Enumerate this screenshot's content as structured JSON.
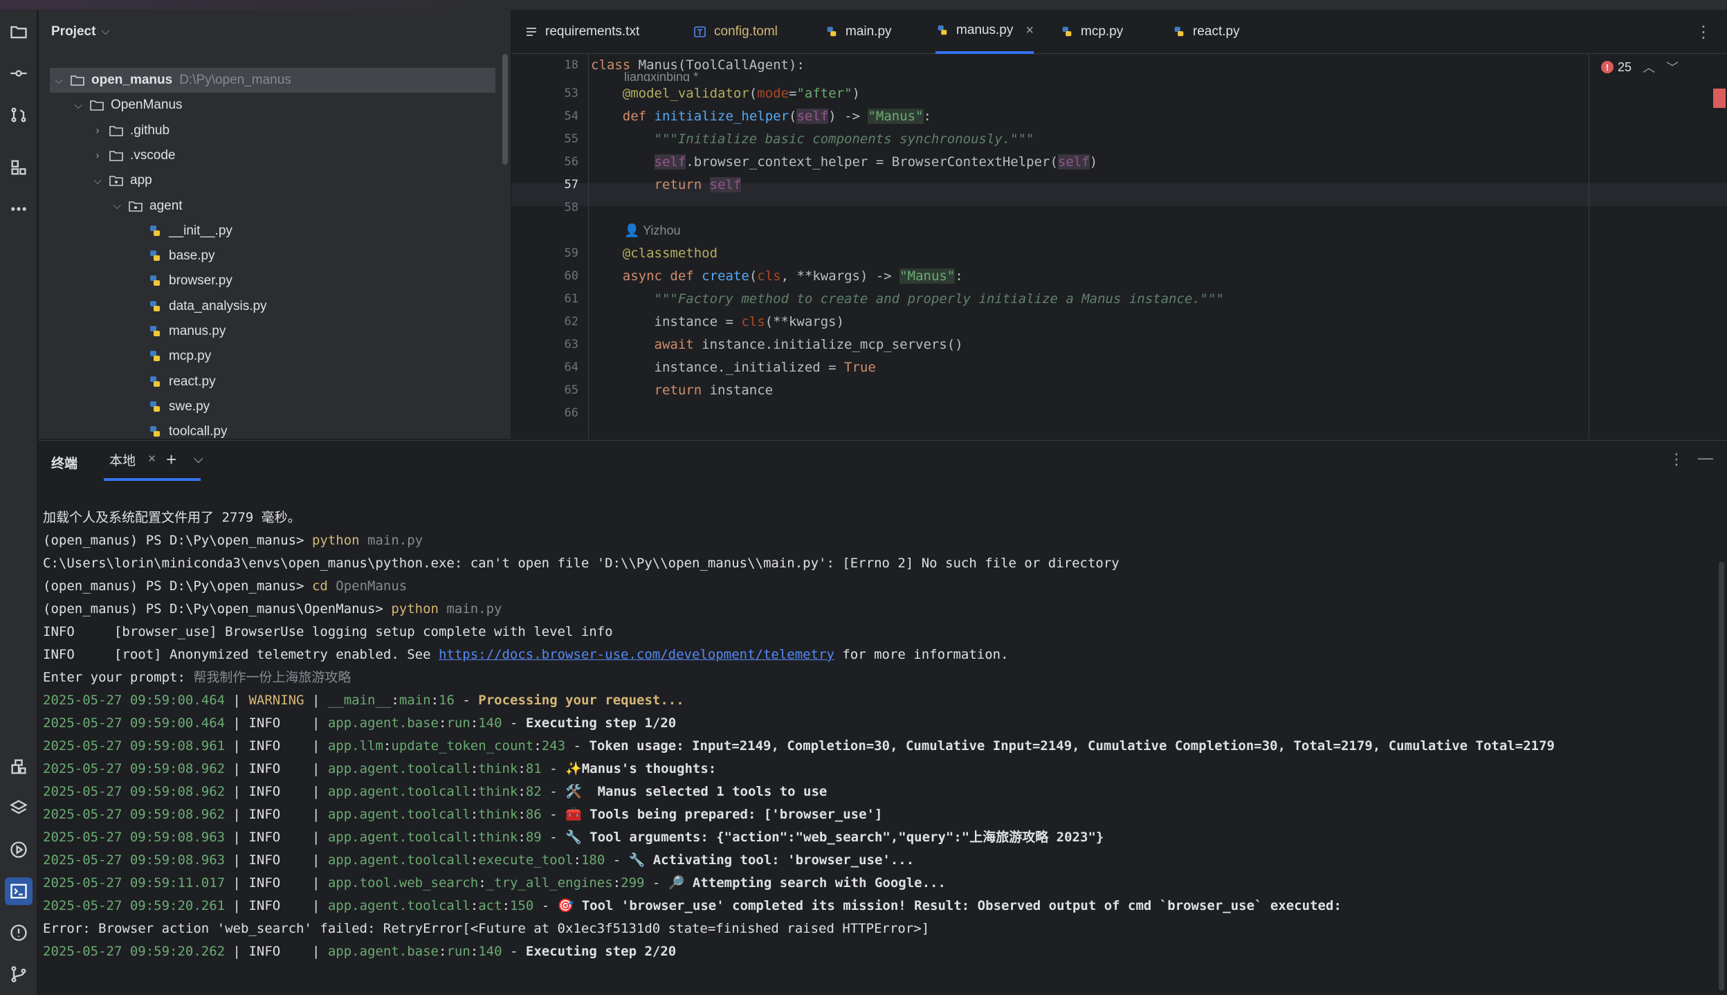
{
  "project_panel": {
    "title": "Project",
    "tree": [
      {
        "label": "open_manus",
        "path": "D:\\Py\\open_manus",
        "kind": "folder",
        "expanded": true,
        "selected": true
      },
      {
        "label": "OpenManus",
        "kind": "folder",
        "expanded": true
      },
      {
        "label": ".github",
        "kind": "folder",
        "expanded": false
      },
      {
        "label": ".vscode",
        "kind": "folder",
        "expanded": false
      },
      {
        "label": "app",
        "kind": "package",
        "expanded": true
      },
      {
        "label": "agent",
        "kind": "package",
        "expanded": true
      },
      {
        "label": "__init__.py",
        "kind": "python"
      },
      {
        "label": "base.py",
        "kind": "python"
      },
      {
        "label": "browser.py",
        "kind": "python"
      },
      {
        "label": "data_analysis.py",
        "kind": "python"
      },
      {
        "label": "manus.py",
        "kind": "python"
      },
      {
        "label": "mcp.py",
        "kind": "python"
      },
      {
        "label": "react.py",
        "kind": "python"
      },
      {
        "label": "swe.py",
        "kind": "python"
      },
      {
        "label": "toolcall.py",
        "kind": "python"
      }
    ]
  },
  "editor": {
    "tabs": [
      {
        "label": "requirements.txt",
        "icon": "text-file-icon"
      },
      {
        "label": "config.toml",
        "icon": "toml-file-icon"
      },
      {
        "label": "main.py",
        "icon": "python-icon"
      },
      {
        "label": "manus.py",
        "icon": "python-icon",
        "active": true
      },
      {
        "label": "mcp.py",
        "icon": "python-icon"
      },
      {
        "label": "react.py",
        "icon": "python-icon"
      }
    ],
    "problems_count": "25",
    "sticky_line_number": "18",
    "sticky_line": "class Manus(ToolCallAgent):",
    "author_hint_1": "liangxinbing *",
    "author_hint_2": "Yizhou",
    "line_numbers": [
      "53",
      "54",
      "55",
      "56",
      "57",
      "58",
      "59",
      "60",
      "61",
      "62",
      "63",
      "64",
      "65",
      "66"
    ],
    "current_line": "57"
  },
  "terminal": {
    "title": "终端",
    "tab": "本地",
    "lines": {
      "l1": "加载个人及系统配置文件用了 2779 毫秒。",
      "prompt1": "(open_manus) PS D:\\Py\\open_manus> ",
      "cmd1": "python",
      "arg1": " main.py",
      "err1": "C:\\Users\\lorin\\miniconda3\\envs\\open_manus\\python.exe: can't open file 'D:\\\\Py\\\\open_manus\\\\main.py': [Errno 2] No such file or directory",
      "prompt2": "(open_manus) PS D:\\Py\\open_manus> ",
      "cmd2": "cd",
      "arg2": " OpenManus",
      "prompt3": "(open_manus) PS D:\\Py\\open_manus\\OpenManus> ",
      "cmd3": "python",
      "arg3": " main.py",
      "info1": "INFO     [browser_use] BrowserUse logging setup complete with level info",
      "info2_pre": "INFO     [root] Anonymized telemetry enabled. See ",
      "info2_link": "https://docs.browser-use.com/development/telemetry",
      "info2_post": " for more information.",
      "enter_prompt": "Enter your prompt: ",
      "prompt_text": "帮我制作一份上海旅游攻略"
    },
    "logs": [
      {
        "ts": "2025-05-27 09:59:00.464",
        "level": "WARNING",
        "mod": "__main__",
        "fn": "main",
        "ln": "16",
        "msg": "Processing your request..."
      },
      {
        "ts": "2025-05-27 09:59:00.464",
        "level": "INFO   ",
        "mod": "app.agent.base",
        "fn": "run",
        "ln": "140",
        "msg": "Executing step 1/20"
      },
      {
        "ts": "2025-05-27 09:59:08.961",
        "level": "INFO   ",
        "mod": "app.llm",
        "fn": "update_token_count",
        "ln": "243",
        "msg": "Token usage: Input=2149, Completion=30, Cumulative Input=2149, Cumulative Completion=30, Total=2179, Cumulative Total=2179"
      },
      {
        "ts": "2025-05-27 09:59:08.962",
        "level": "INFO   ",
        "mod": "app.agent.toolcall",
        "fn": "think",
        "ln": "81",
        "msg": "✨Manus's thoughts:"
      },
      {
        "ts": "2025-05-27 09:59:08.962",
        "level": "INFO   ",
        "mod": "app.agent.toolcall",
        "fn": "think",
        "ln": "82",
        "msg": "🛠️  Manus selected 1 tools to use"
      },
      {
        "ts": "2025-05-27 09:59:08.962",
        "level": "INFO   ",
        "mod": "app.agent.toolcall",
        "fn": "think",
        "ln": "86",
        "msg": "🧰 Tools being prepared: ['browser_use']"
      },
      {
        "ts": "2025-05-27 09:59:08.963",
        "level": "INFO   ",
        "mod": "app.agent.toolcall",
        "fn": "think",
        "ln": "89",
        "msg": "🔧 Tool arguments: {\"action\":\"web_search\",\"query\":\"上海旅游攻略 2023\"}"
      },
      {
        "ts": "2025-05-27 09:59:08.963",
        "level": "INFO   ",
        "mod": "app.agent.toolcall",
        "fn": "execute_tool",
        "ln": "180",
        "msg": "🔧 Activating tool: 'browser_use'..."
      },
      {
        "ts": "2025-05-27 09:59:11.017",
        "level": "INFO   ",
        "mod": "app.tool.web_search",
        "fn": "_try_all_engines",
        "ln": "299",
        "msg": "🔎 Attempting search with Google..."
      },
      {
        "ts": "2025-05-27 09:59:20.261",
        "level": "INFO   ",
        "mod": "app.agent.toolcall",
        "fn": "act",
        "ln": "150",
        "msg": "🎯 Tool 'browser_use' completed its mission! Result: Observed output of cmd `browser_use` executed:"
      }
    ],
    "error_line": "Error: Browser action 'web_search' failed: RetryError[<Future at 0x1ec3f5131d0 state=finished raised HTTPError>]",
    "last_log": {
      "ts": "2025-05-27 09:59:20.262",
      "level": "INFO   ",
      "mod": "app.agent.base",
      "fn": "run",
      "ln": "140",
      "msg": "Executing step 2/20"
    }
  },
  "colors": {
    "accent": "#3574f0",
    "error": "#db5c5c",
    "green": "#6aab73",
    "yellow": "#d5b778"
  }
}
